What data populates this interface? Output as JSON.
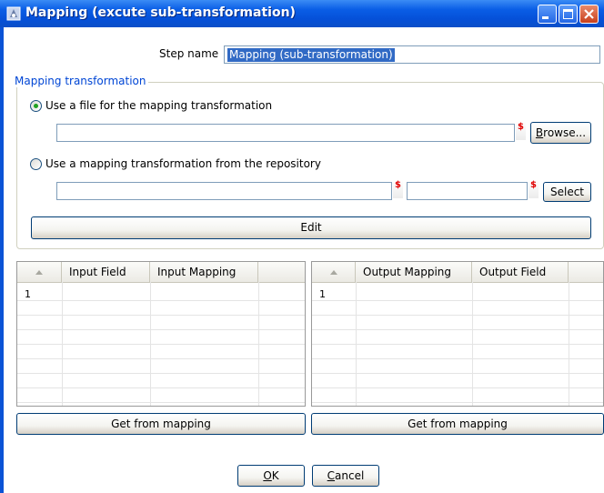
{
  "window": {
    "title": "Mapping (excute sub-transformation)"
  },
  "step_name": {
    "label": "Step name",
    "value": "Mapping (sub-transformation)"
  },
  "mapping_group": {
    "title": "Mapping transformation",
    "option_file": {
      "label": "Use a file for the mapping transformation",
      "selected": true,
      "value": ""
    },
    "browse_button": {
      "first": "B",
      "rest": "rowse..."
    },
    "option_repo": {
      "label": "Use a mapping transformation from the repository",
      "selected": false,
      "directory_value": "",
      "name_value": ""
    },
    "variable_marker": "$",
    "select_button": "Select",
    "edit_button": "Edit"
  },
  "input_grid": {
    "columns": [
      "Input Field",
      "Input Mapping"
    ],
    "rows": [
      {
        "num": "1",
        "cells": [
          "",
          ""
        ]
      }
    ],
    "get_button": "Get from mapping"
  },
  "output_grid": {
    "columns": [
      "Output Mapping",
      "Output Field"
    ],
    "rows": [
      {
        "num": "1",
        "cells": [
          "",
          ""
        ]
      }
    ],
    "get_button": "Get from mapping"
  },
  "ok_button": {
    "first": "O",
    "rest": "K"
  },
  "cancel_button": {
    "first": "C",
    "rest": "ancel"
  },
  "colors": {
    "title_bar": "#0a53d6",
    "group_title": "#0046d5",
    "radio_selected": "#21a121",
    "variable_marker": "#e00000",
    "selection": "#316ac5"
  }
}
